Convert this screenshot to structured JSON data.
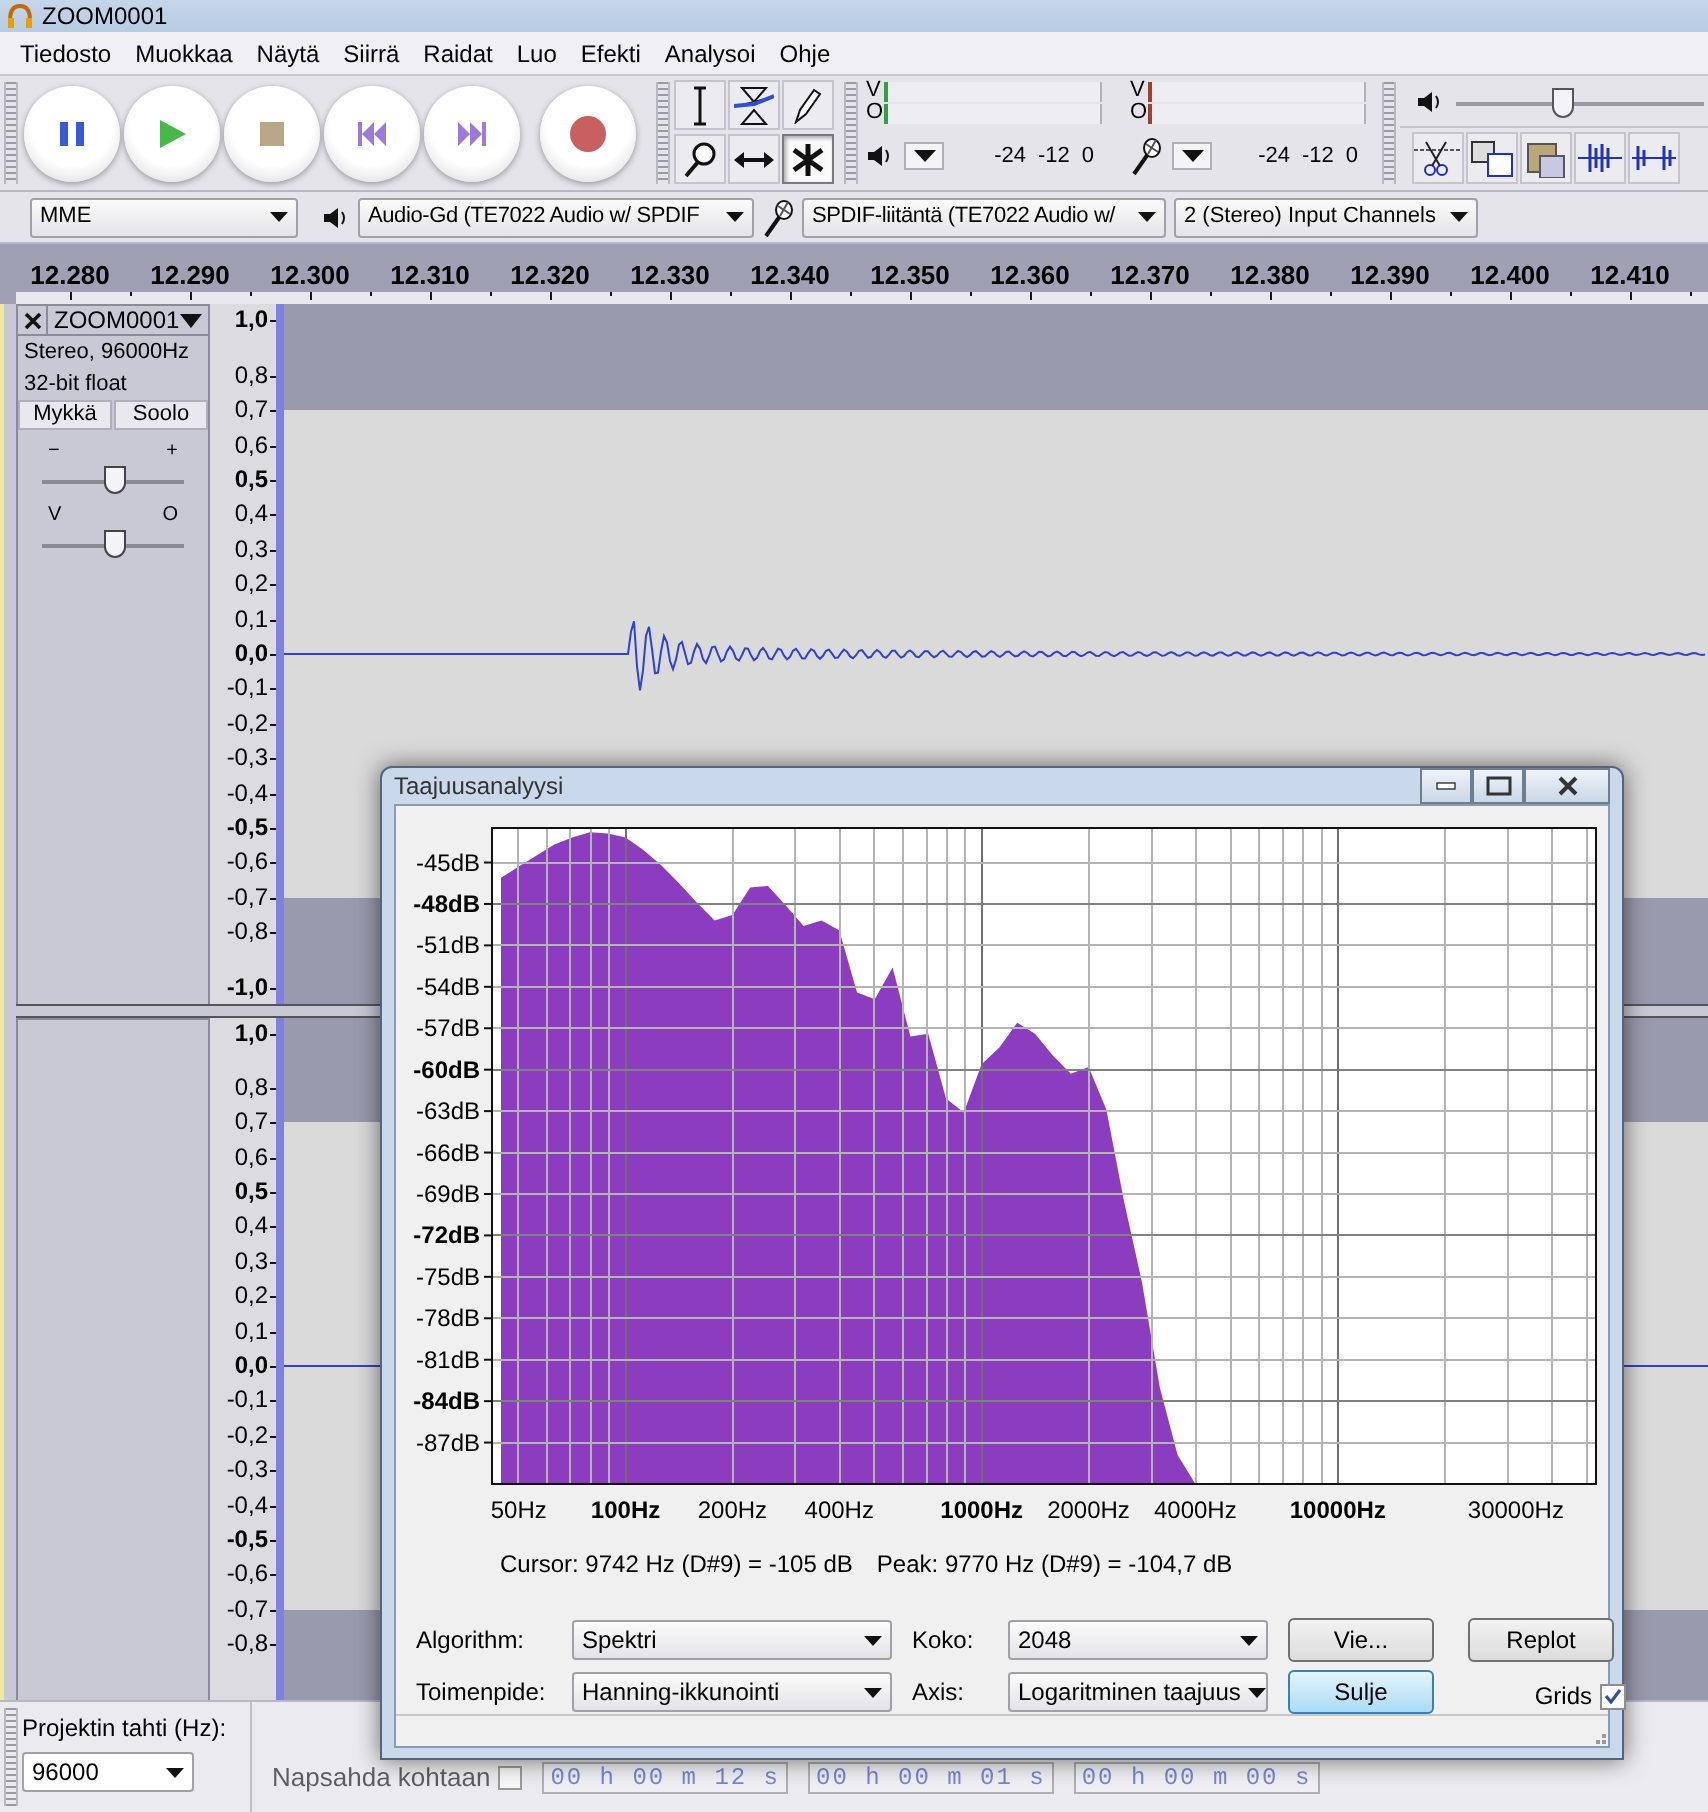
{
  "window": {
    "title": "ZOOM0001"
  },
  "menu": [
    "Tiedosto",
    "Muokkaa",
    "Näytä",
    "Siirrä",
    "Raidat",
    "Luo",
    "Efekti",
    "Analysoi",
    "Ohje"
  ],
  "tools": [
    {
      "kind": "select",
      "selected": false
    },
    {
      "kind": "envelope",
      "selected": false
    },
    {
      "kind": "draw",
      "selected": false
    },
    {
      "kind": "zoom",
      "selected": false
    },
    {
      "kind": "timeshift",
      "selected": false
    },
    {
      "kind": "multi",
      "selected": true
    }
  ],
  "meters": [
    {
      "kind": "playback",
      "channels": [
        "V",
        "O"
      ],
      "scale": [
        "-24",
        "-12",
        "0"
      ]
    },
    {
      "kind": "recording",
      "channels": [
        "V",
        "O"
      ],
      "scale": [
        "-24",
        "-12",
        "0"
      ]
    }
  ],
  "output_volume": {
    "level": 0.43
  },
  "devices": {
    "host": "MME",
    "output": "Audio-Gd (TE7022 Audio w/ SPDIF",
    "input": "SPDIF-liitäntä (TE7022 Audio w/",
    "channels": "2 (Stereo) Input Channels"
  },
  "timeline": [
    "12.280",
    "12.290",
    "12.300",
    "12.310",
    "12.320",
    "12.330",
    "12.340",
    "12.350",
    "12.360",
    "12.370",
    "12.380",
    "12.390",
    "12.400",
    "12.410"
  ],
  "track": {
    "name": "ZOOM0001",
    "info": [
      "Stereo, 96000Hz",
      "32-bit float"
    ],
    "buttons": [
      {
        "label": "Mykkä",
        "on": false
      },
      {
        "label": "Soolo",
        "on": false
      }
    ],
    "gain": {
      "min_label": "−",
      "max_label": "+",
      "level": 0.5
    },
    "pan": {
      "min_label": "V",
      "max_label": "O",
      "level": 0.5
    },
    "channels": [
      {
        "ruler": [
          "1,0",
          "0,8",
          "0,7",
          "0,6",
          "0,5",
          "0,4",
          "0,3",
          "0,2",
          "0,1",
          "0,0",
          "-0,1",
          "-0,2",
          "-0,3",
          "-0,4",
          "-0,5",
          "-0,6",
          "-0,7",
          "-0,8",
          "-1,0"
        ]
      },
      {
        "ruler": [
          "1,0",
          "0,8",
          "0,7",
          "0,6",
          "0,5",
          "0,4",
          "0,3",
          "0,2",
          "0,1",
          "0,0",
          "-0,1",
          "-0,2",
          "-0,3",
          "-0,4",
          "-0,5",
          "-0,6",
          "-0,7",
          "-0,8"
        ]
      }
    ]
  },
  "bottom_bar": {
    "rate_label": "Projektin tahti (Hz):",
    "rate": "96000",
    "snap_label": "Napsahda kohtaan",
    "snap_checked": false,
    "times": [
      "00 h 00 m 12 s",
      "00 h 00 m 01 s",
      "00 h 00 m 00 s"
    ]
  },
  "dialog": {
    "title": "Taajuusanalyysi",
    "chart_data": {
      "type": "area",
      "grid": true,
      "ylim": [
        -90,
        -42.5
      ],
      "categories": [
        null,
        "50Hz",
        null,
        null,
        null,
        null,
        null,
        "100Hz",
        null,
        null,
        null,
        null,
        null,
        "200Hz",
        null,
        null,
        null,
        null,
        null,
        "400Hz",
        null,
        null,
        null,
        null,
        null,
        null,
        null,
        "1000Hz",
        null,
        null,
        null,
        null,
        null,
        "2000Hz",
        null,
        null,
        null,
        null,
        null,
        "4000Hz",
        null,
        null,
        null,
        null,
        null,
        null,
        null,
        "10000Hz",
        null,
        null,
        null,
        null,
        null,
        null,
        null,
        null,
        null,
        "30000Hz",
        null,
        null,
        null,
        null
      ],
      "series": [
        {
          "color": "#8c3cbe",
          "values": [
            -46.1,
            -45.3,
            -44.5,
            -43.7,
            -43.2,
            -42.8,
            -42.9,
            -43.2,
            -44.1,
            -45.2,
            -46.5,
            -47.9,
            -49.2,
            -48.8,
            -46.8,
            -46.7,
            -48.1,
            -49.6,
            -49.2,
            -49.9,
            -54.4,
            -54.9,
            -52.6,
            -57.6,
            -57.4,
            -62.1,
            -63.1,
            -59.6,
            -58.4,
            -56.6,
            -57.4,
            -59,
            -60.3,
            -59.8,
            -62.9,
            -69.6,
            -75.4,
            -83,
            -87.9,
            -90,
            null,
            null,
            null,
            null,
            null,
            null,
            null,
            null,
            null,
            null,
            null,
            null,
            null,
            null,
            null,
            null,
            null,
            null,
            null,
            null,
            null,
            null
          ]
        }
      ],
      "yticks": [
        {
          "value": -45,
          "label": "-45dB"
        },
        {
          "value": -48,
          "label": "-48dB"
        },
        {
          "value": -51,
          "label": "-51dB"
        },
        {
          "value": -54,
          "label": "-54dB"
        },
        {
          "value": -57,
          "label": "-57dB"
        },
        {
          "value": -60,
          "label": "-60dB"
        },
        {
          "value": -63,
          "label": "-63dB"
        },
        {
          "value": -66,
          "label": "-66dB"
        },
        {
          "value": -69,
          "label": "-69dB"
        },
        {
          "value": -72,
          "label": "-72dB"
        },
        {
          "value": -75,
          "label": "-75dB"
        },
        {
          "value": -78,
          "label": "-78dB"
        },
        {
          "value": -81,
          "label": "-81dB"
        },
        {
          "value": -84,
          "label": "-84dB"
        },
        {
          "value": -87,
          "label": "-87dB"
        }
      ]
    },
    "cursor": "Cursor: 9742 Hz (D#9) = -105 dB",
    "peak": "Peak: 9770 Hz (D#9) = -104,7 dB",
    "controls": [
      {
        "label": "Algorithm:",
        "value": "Spektri"
      },
      {
        "label": "Koko:",
        "value": "2048"
      },
      {
        "label": "Toimenpide:",
        "value": "Hanning-ikkunointi"
      },
      {
        "label": "Axis:",
        "value": "Logaritminen taajuus"
      }
    ],
    "buttons": [
      {
        "label": "Vie...",
        "focused": false
      },
      {
        "label": "Replot",
        "focused": false
      },
      {
        "label": "Sulje",
        "focused": true
      }
    ],
    "grids": {
      "label": "Grids",
      "checked": true
    }
  }
}
